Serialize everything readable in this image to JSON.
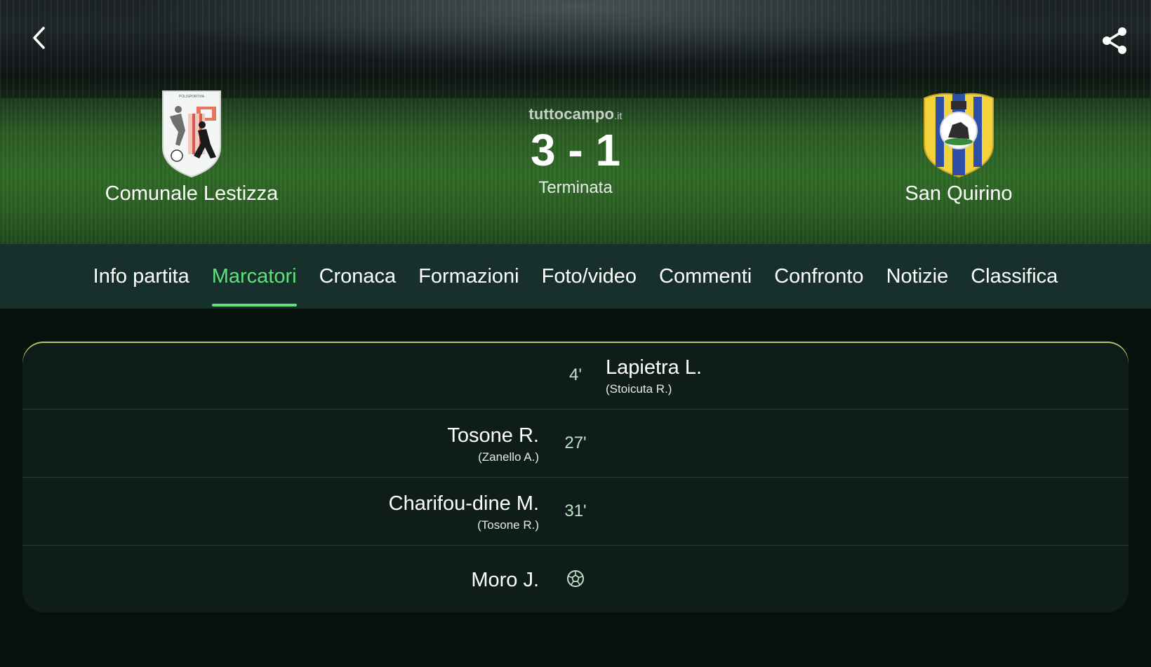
{
  "header": {
    "brand": "tuttocampo",
    "brand_tld": ".it",
    "home_team": "Comunale Lestizza",
    "away_team": "San Quirino",
    "score": "3 - 1",
    "status": "Terminata"
  },
  "tabs": [
    {
      "label": "Info partita",
      "active": false
    },
    {
      "label": "Marcatori",
      "active": true
    },
    {
      "label": "Cronaca",
      "active": false
    },
    {
      "label": "Formazioni",
      "active": false
    },
    {
      "label": "Foto/video",
      "active": false
    },
    {
      "label": "Commenti",
      "active": false
    },
    {
      "label": "Confronto",
      "active": false
    },
    {
      "label": "Notizie",
      "active": false
    },
    {
      "label": "Classifica",
      "active": false
    }
  ],
  "goals": [
    {
      "minute": "4'",
      "side": "away",
      "scorer": "Lapietra L.",
      "assist": "(Stoicuta R.)"
    },
    {
      "minute": "27'",
      "side": "home",
      "scorer": "Tosone R.",
      "assist": "(Zanello A.)"
    },
    {
      "minute": "31'",
      "side": "home",
      "scorer": "Charifou-dine M.",
      "assist": "(Tosone R.)"
    },
    {
      "minute": "",
      "side": "home",
      "scorer": "Moro J.",
      "assist": ""
    }
  ],
  "colors": {
    "accent": "#5fe07a",
    "tab_bar": "#17302b",
    "card": "#0e1c1a",
    "page": "#07120f"
  }
}
